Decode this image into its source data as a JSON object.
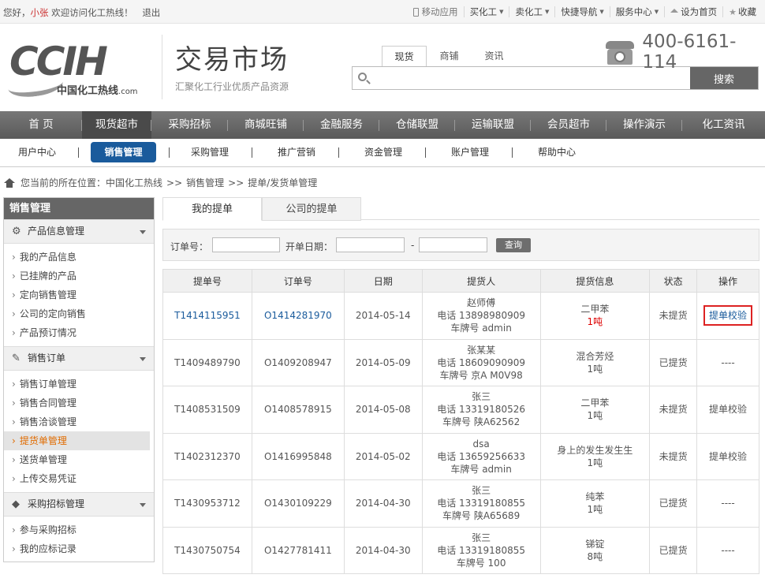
{
  "topbar": {
    "greeting_prefix": "您好，",
    "username": "小张",
    "welcome": "欢迎访问化工热线！",
    "logout": "退出",
    "mobile": "移动应用",
    "buy": "买化工",
    "sell": "卖化工",
    "quicknav": "快捷导航",
    "service": "服务中心",
    "set_home": "设为首页",
    "favorite": "收藏"
  },
  "header": {
    "logo_text": "CCIH",
    "logo_cn": "中国化工热线",
    "logo_domain": ".com",
    "title": "交易市场",
    "subtitle": "汇聚化工行业优质产品资源",
    "hotline": "400-6161-114"
  },
  "search": {
    "tabs": [
      "现货",
      "商铺",
      "资讯"
    ],
    "placeholder": "",
    "button": "搜索"
  },
  "mainnav": [
    "首 页",
    "现货超市",
    "采购招标",
    "商城旺铺",
    "金融服务",
    "仓储联盟",
    "运输联盟",
    "会员超市",
    "操作演示",
    "化工资讯"
  ],
  "subnav": [
    "用户中心",
    "销售管理",
    "采购管理",
    "推广营销",
    "资金管理",
    "账户管理",
    "帮助中心"
  ],
  "breadcrumb": {
    "prefix": "您当前的所在位置：",
    "site": "中国化工热线",
    "level1": "销售管理",
    "level2": "提单/发货单管理",
    "sep": ">>"
  },
  "sidebar": {
    "title": "销售管理",
    "groups": [
      {
        "label": "产品信息管理",
        "items": [
          "我的产品信息",
          "已挂牌的产品",
          "定向销售管理",
          "公司的定向销售",
          "产品预订情况"
        ]
      },
      {
        "label": "销售订单",
        "items": [
          "销售订单管理",
          "销售合同管理",
          "销售洽谈管理",
          "提货单管理",
          "送货单管理",
          "上传交易凭证"
        ]
      },
      {
        "label": "采购招标管理",
        "items": [
          "参与采购招标",
          "我的应标记录"
        ]
      }
    ]
  },
  "tabs": [
    "我的提单",
    "公司的提单"
  ],
  "filter": {
    "order_label": "订单号：",
    "date_label": "开单日期：",
    "dash": "-",
    "query": "查询"
  },
  "table": {
    "headers": [
      "提单号",
      "订单号",
      "日期",
      "提货人",
      "提货信息",
      "状态",
      "操作"
    ],
    "rows": [
      {
        "bill": "T1414115951",
        "order": "O1414281970",
        "date": "2014-05-14",
        "name": "赵师傅",
        "phone": "电话 13898980909",
        "plate": "车牌号 admin",
        "product": "二甲苯",
        "qty": "1吨",
        "status": "未提货",
        "action": "提单校验"
      },
      {
        "bill": "T1409489790",
        "order": "O1409208947",
        "date": "2014-05-09",
        "name": "张某某",
        "phone": "电话 18609090909",
        "plate": "车牌号 京A M0V98",
        "product": "混合芳烃",
        "qty": "1吨",
        "status": "已提货",
        "action": "----"
      },
      {
        "bill": "T1408531509",
        "order": "O1408578915",
        "date": "2014-05-08",
        "name": "张三",
        "phone": "电话 13319180526",
        "plate": "车牌号 陕A62562",
        "product": "二甲苯",
        "qty": "1吨",
        "status": "未提货",
        "action": "提单校验"
      },
      {
        "bill": "T1402312370",
        "order": "O1416995848",
        "date": "2014-05-02",
        "name": "dsa",
        "phone": "电话 13659256633",
        "plate": "车牌号 admin",
        "product": "身上的发生发生生",
        "qty": "1吨",
        "status": "未提货",
        "action": "提单校验"
      },
      {
        "bill": "T1430953712",
        "order": "O1430109229",
        "date": "2014-04-30",
        "name": "张三",
        "phone": "电话 13319180855",
        "plate": "车牌号 陕A65689",
        "product": "纯苯",
        "qty": "1吨",
        "status": "已提货",
        "action": "----"
      },
      {
        "bill": "T1430750754",
        "order": "O1427781411",
        "date": "2014-04-30",
        "name": "张三",
        "phone": "电话 13319180855",
        "plate": "车牌号 100",
        "product": "锑锭",
        "qty": "8吨",
        "status": "已提货",
        "action": "----"
      }
    ]
  }
}
